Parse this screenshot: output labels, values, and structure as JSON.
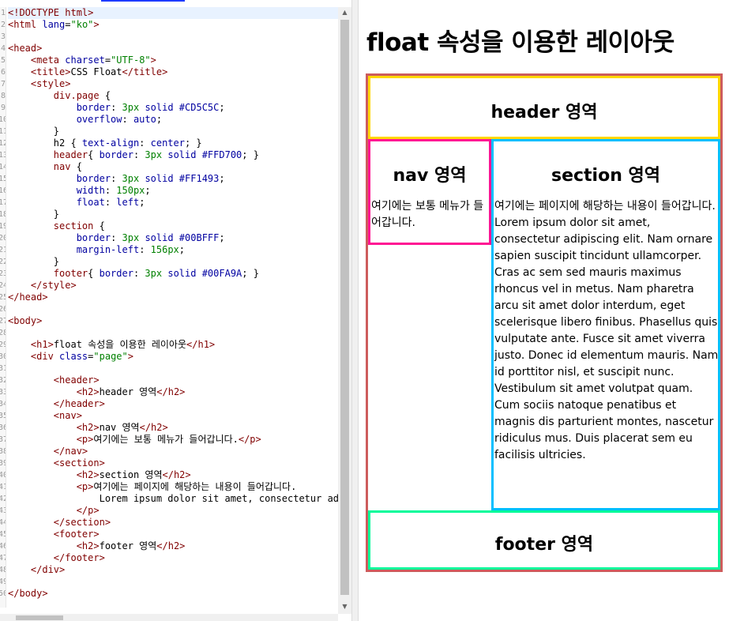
{
  "editor": {
    "code_lines": [
      {
        "segs": [
          {
            "c": "tok-tag",
            "t": "<!DOCTYPE html>"
          }
        ],
        "active": true
      },
      {
        "segs": [
          {
            "c": "tok-tag",
            "t": "<html "
          },
          {
            "c": "tok-attr",
            "t": "lang"
          },
          {
            "c": "tok-text",
            "t": "="
          },
          {
            "c": "tok-val",
            "t": "\"ko\""
          },
          {
            "c": "tok-tag",
            "t": ">"
          }
        ]
      },
      {
        "segs": []
      },
      {
        "segs": [
          {
            "c": "tok-tag",
            "t": "<head>"
          }
        ]
      },
      {
        "segs": [
          {
            "c": "tok-text",
            "t": "    "
          },
          {
            "c": "tok-tag",
            "t": "<meta "
          },
          {
            "c": "tok-attr",
            "t": "charset"
          },
          {
            "c": "tok-text",
            "t": "="
          },
          {
            "c": "tok-val",
            "t": "\"UTF-8\""
          },
          {
            "c": "tok-tag",
            "t": ">"
          }
        ]
      },
      {
        "segs": [
          {
            "c": "tok-text",
            "t": "    "
          },
          {
            "c": "tok-tag",
            "t": "<title>"
          },
          {
            "c": "tok-text",
            "t": "CSS Float"
          },
          {
            "c": "tok-tag",
            "t": "</title>"
          }
        ]
      },
      {
        "segs": [
          {
            "c": "tok-text",
            "t": "    "
          },
          {
            "c": "tok-tag",
            "t": "<style>"
          }
        ]
      },
      {
        "segs": [
          {
            "c": "tok-text",
            "t": "        "
          },
          {
            "c": "tok-tag",
            "t": "div.page"
          },
          {
            "c": "tok-text",
            "t": " {"
          }
        ]
      },
      {
        "segs": [
          {
            "c": "tok-text",
            "t": "            "
          },
          {
            "c": "tok-prop",
            "t": "border"
          },
          {
            "c": "tok-text",
            "t": ": "
          },
          {
            "c": "tok-num",
            "t": "3px"
          },
          {
            "c": "tok-text",
            "t": " "
          },
          {
            "c": "tok-prop",
            "t": "solid"
          },
          {
            "c": "tok-text",
            "t": " "
          },
          {
            "c": "tok-prop",
            "t": "#CD5C5C"
          },
          {
            "c": "tok-text",
            "t": ";"
          }
        ]
      },
      {
        "segs": [
          {
            "c": "tok-text",
            "t": "            "
          },
          {
            "c": "tok-prop",
            "t": "overflow"
          },
          {
            "c": "tok-text",
            "t": ": "
          },
          {
            "c": "tok-prop",
            "t": "auto"
          },
          {
            "c": "tok-text",
            "t": ";"
          }
        ]
      },
      {
        "segs": [
          {
            "c": "tok-text",
            "t": "        }"
          }
        ]
      },
      {
        "segs": [
          {
            "c": "tok-text",
            "t": "        h2 { "
          },
          {
            "c": "tok-prop",
            "t": "text-align"
          },
          {
            "c": "tok-text",
            "t": ": "
          },
          {
            "c": "tok-prop",
            "t": "center"
          },
          {
            "c": "tok-text",
            "t": "; }"
          }
        ]
      },
      {
        "segs": [
          {
            "c": "tok-text",
            "t": "        "
          },
          {
            "c": "tok-tag",
            "t": "header"
          },
          {
            "c": "tok-text",
            "t": "{ "
          },
          {
            "c": "tok-prop",
            "t": "border"
          },
          {
            "c": "tok-text",
            "t": ": "
          },
          {
            "c": "tok-num",
            "t": "3px"
          },
          {
            "c": "tok-text",
            "t": " "
          },
          {
            "c": "tok-prop",
            "t": "solid"
          },
          {
            "c": "tok-text",
            "t": " "
          },
          {
            "c": "tok-prop",
            "t": "#FFD700"
          },
          {
            "c": "tok-text",
            "t": "; }"
          }
        ]
      },
      {
        "segs": [
          {
            "c": "tok-text",
            "t": "        "
          },
          {
            "c": "tok-tag",
            "t": "nav"
          },
          {
            "c": "tok-text",
            "t": " {"
          }
        ]
      },
      {
        "segs": [
          {
            "c": "tok-text",
            "t": "            "
          },
          {
            "c": "tok-prop",
            "t": "border"
          },
          {
            "c": "tok-text",
            "t": ": "
          },
          {
            "c": "tok-num",
            "t": "3px"
          },
          {
            "c": "tok-text",
            "t": " "
          },
          {
            "c": "tok-prop",
            "t": "solid"
          },
          {
            "c": "tok-text",
            "t": " "
          },
          {
            "c": "tok-prop",
            "t": "#FF1493"
          },
          {
            "c": "tok-text",
            "t": ";"
          }
        ]
      },
      {
        "segs": [
          {
            "c": "tok-text",
            "t": "            "
          },
          {
            "c": "tok-prop",
            "t": "width"
          },
          {
            "c": "tok-text",
            "t": ": "
          },
          {
            "c": "tok-num",
            "t": "150px"
          },
          {
            "c": "tok-text",
            "t": ";"
          }
        ]
      },
      {
        "segs": [
          {
            "c": "tok-text",
            "t": "            "
          },
          {
            "c": "tok-prop",
            "t": "float"
          },
          {
            "c": "tok-text",
            "t": ": "
          },
          {
            "c": "tok-prop",
            "t": "left"
          },
          {
            "c": "tok-text",
            "t": ";"
          }
        ]
      },
      {
        "segs": [
          {
            "c": "tok-text",
            "t": "        }"
          }
        ]
      },
      {
        "segs": [
          {
            "c": "tok-text",
            "t": "        "
          },
          {
            "c": "tok-tag",
            "t": "section"
          },
          {
            "c": "tok-text",
            "t": " {"
          }
        ]
      },
      {
        "segs": [
          {
            "c": "tok-text",
            "t": "            "
          },
          {
            "c": "tok-prop",
            "t": "border"
          },
          {
            "c": "tok-text",
            "t": ": "
          },
          {
            "c": "tok-num",
            "t": "3px"
          },
          {
            "c": "tok-text",
            "t": " "
          },
          {
            "c": "tok-prop",
            "t": "solid"
          },
          {
            "c": "tok-text",
            "t": " "
          },
          {
            "c": "tok-prop",
            "t": "#00BFFF"
          },
          {
            "c": "tok-text",
            "t": ";"
          }
        ]
      },
      {
        "segs": [
          {
            "c": "tok-text",
            "t": "            "
          },
          {
            "c": "tok-prop",
            "t": "margin-left"
          },
          {
            "c": "tok-text",
            "t": ": "
          },
          {
            "c": "tok-num",
            "t": "156px"
          },
          {
            "c": "tok-text",
            "t": ";"
          }
        ]
      },
      {
        "segs": [
          {
            "c": "tok-text",
            "t": "        }"
          }
        ]
      },
      {
        "segs": [
          {
            "c": "tok-text",
            "t": "        "
          },
          {
            "c": "tok-tag",
            "t": "footer"
          },
          {
            "c": "tok-text",
            "t": "{ "
          },
          {
            "c": "tok-prop",
            "t": "border"
          },
          {
            "c": "tok-text",
            "t": ": "
          },
          {
            "c": "tok-num",
            "t": "3px"
          },
          {
            "c": "tok-text",
            "t": " "
          },
          {
            "c": "tok-prop",
            "t": "solid"
          },
          {
            "c": "tok-text",
            "t": " "
          },
          {
            "c": "tok-prop",
            "t": "#00FA9A"
          },
          {
            "c": "tok-text",
            "t": "; }"
          }
        ]
      },
      {
        "segs": [
          {
            "c": "tok-text",
            "t": "    "
          },
          {
            "c": "tok-tag",
            "t": "</style>"
          }
        ]
      },
      {
        "segs": [
          {
            "c": "tok-tag",
            "t": "</head>"
          }
        ]
      },
      {
        "segs": []
      },
      {
        "segs": [
          {
            "c": "tok-tag",
            "t": "<body>"
          }
        ]
      },
      {
        "segs": []
      },
      {
        "segs": [
          {
            "c": "tok-text",
            "t": "    "
          },
          {
            "c": "tok-tag",
            "t": "<h1>"
          },
          {
            "c": "tok-text",
            "t": "float 속성을 이용한 레이아웃"
          },
          {
            "c": "tok-tag",
            "t": "</h1>"
          }
        ]
      },
      {
        "segs": [
          {
            "c": "tok-text",
            "t": "    "
          },
          {
            "c": "tok-tag",
            "t": "<div "
          },
          {
            "c": "tok-attr",
            "t": "class"
          },
          {
            "c": "tok-text",
            "t": "="
          },
          {
            "c": "tok-val",
            "t": "\"page\""
          },
          {
            "c": "tok-tag",
            "t": ">"
          }
        ]
      },
      {
        "segs": []
      },
      {
        "segs": [
          {
            "c": "tok-text",
            "t": "        "
          },
          {
            "c": "tok-tag",
            "t": "<header>"
          }
        ]
      },
      {
        "segs": [
          {
            "c": "tok-text",
            "t": "            "
          },
          {
            "c": "tok-tag",
            "t": "<h2>"
          },
          {
            "c": "tok-text",
            "t": "header 영역"
          },
          {
            "c": "tok-tag",
            "t": "</h2>"
          }
        ]
      },
      {
        "segs": [
          {
            "c": "tok-text",
            "t": "        "
          },
          {
            "c": "tok-tag",
            "t": "</header>"
          }
        ]
      },
      {
        "segs": [
          {
            "c": "tok-text",
            "t": "        "
          },
          {
            "c": "tok-tag",
            "t": "<nav>"
          }
        ]
      },
      {
        "segs": [
          {
            "c": "tok-text",
            "t": "            "
          },
          {
            "c": "tok-tag",
            "t": "<h2>"
          },
          {
            "c": "tok-text",
            "t": "nav 영역"
          },
          {
            "c": "tok-tag",
            "t": "</h2>"
          }
        ]
      },
      {
        "segs": [
          {
            "c": "tok-text",
            "t": "            "
          },
          {
            "c": "tok-tag",
            "t": "<p>"
          },
          {
            "c": "tok-text",
            "t": "여기에는 보통 메뉴가 들어갑니다."
          },
          {
            "c": "tok-tag",
            "t": "</p>"
          }
        ]
      },
      {
        "segs": [
          {
            "c": "tok-text",
            "t": "        "
          },
          {
            "c": "tok-tag",
            "t": "</nav>"
          }
        ]
      },
      {
        "segs": [
          {
            "c": "tok-text",
            "t": "        "
          },
          {
            "c": "tok-tag",
            "t": "<section>"
          }
        ]
      },
      {
        "segs": [
          {
            "c": "tok-text",
            "t": "            "
          },
          {
            "c": "tok-tag",
            "t": "<h2>"
          },
          {
            "c": "tok-text",
            "t": "section 영역"
          },
          {
            "c": "tok-tag",
            "t": "</h2>"
          }
        ]
      },
      {
        "segs": [
          {
            "c": "tok-text",
            "t": "            "
          },
          {
            "c": "tok-tag",
            "t": "<p>"
          },
          {
            "c": "tok-text",
            "t": "여기에는 페이지에 해당하는 내용이 들어갑니다."
          }
        ]
      },
      {
        "segs": [
          {
            "c": "tok-text",
            "t": "                Lorem ipsum dolor sit amet, consectetur adip"
          }
        ]
      },
      {
        "segs": [
          {
            "c": "tok-text",
            "t": "            "
          },
          {
            "c": "tok-tag",
            "t": "</p>"
          }
        ]
      },
      {
        "segs": [
          {
            "c": "tok-text",
            "t": "        "
          },
          {
            "c": "tok-tag",
            "t": "</section>"
          }
        ]
      },
      {
        "segs": [
          {
            "c": "tok-text",
            "t": "        "
          },
          {
            "c": "tok-tag",
            "t": "<footer>"
          }
        ]
      },
      {
        "segs": [
          {
            "c": "tok-text",
            "t": "            "
          },
          {
            "c": "tok-tag",
            "t": "<h2>"
          },
          {
            "c": "tok-text",
            "t": "footer 영역"
          },
          {
            "c": "tok-tag",
            "t": "</h2>"
          }
        ]
      },
      {
        "segs": [
          {
            "c": "tok-text",
            "t": "        "
          },
          {
            "c": "tok-tag",
            "t": "</footer>"
          }
        ]
      },
      {
        "segs": [
          {
            "c": "tok-text",
            "t": "    "
          },
          {
            "c": "tok-tag",
            "t": "</div>"
          }
        ]
      },
      {
        "segs": []
      },
      {
        "segs": [
          {
            "c": "tok-tag",
            "t": "</body>"
          }
        ]
      }
    ]
  },
  "preview": {
    "title": "float 속성을 이용한 레이아웃",
    "header": {
      "heading": "header 영역"
    },
    "nav": {
      "heading": "nav 영역",
      "text": "여기에는 보통 메뉴가 들어갑니다."
    },
    "section": {
      "heading": "section 영역",
      "text": "여기에는 페이지에 해당하는 내용이 들어갑니다. Lorem ipsum dolor sit amet, consectetur adipiscing elit. Nam ornare sapien suscipit tincidunt ullamcorper. Cras ac sem sed mauris maximus rhoncus vel in metus. Nam pharetra arcu sit amet dolor interdum, eget scelerisque libero finibus. Phasellus quis vulputate ante. Fusce sit amet viverra justo. Donec id elementum mauris. Nam id porttitor nisl, et suscipit nunc. Vestibulum sit amet volutpat quam. Cum sociis natoque penatibus et magnis dis parturient montes, nascetur ridiculus mus. Duis placerat sem eu facilisis ultricies."
    },
    "footer": {
      "heading": "footer 영역"
    }
  },
  "colors": {
    "page_border": "#CD5C5C",
    "header_border": "#FFD700",
    "nav_border": "#FF1493",
    "section_border": "#00BFFF",
    "footer_border": "#00FA9A"
  }
}
